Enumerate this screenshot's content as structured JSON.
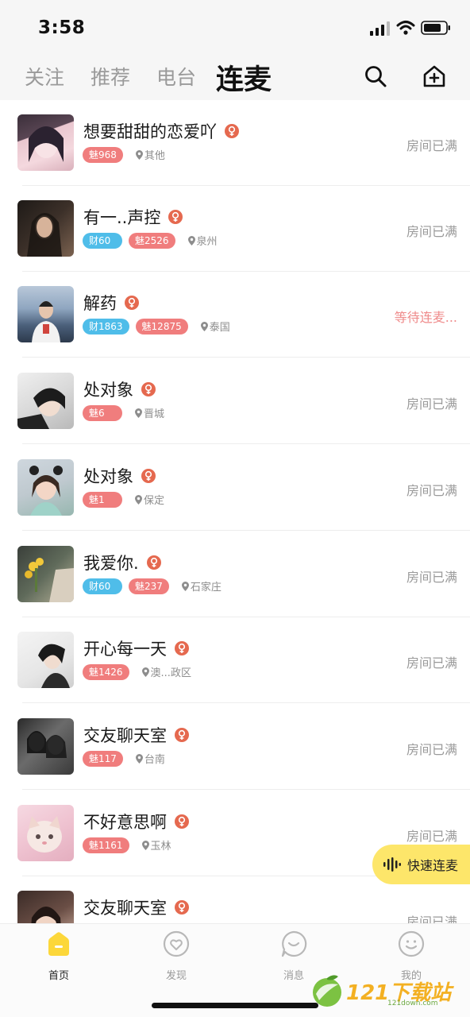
{
  "status_bar": {
    "time": "3:58"
  },
  "top_nav": {
    "tabs": [
      {
        "label": "关注",
        "active": false
      },
      {
        "label": "推荐",
        "active": false
      },
      {
        "label": "电台",
        "active": false
      },
      {
        "label": "连麦",
        "active": true
      }
    ],
    "search_icon": "search-icon",
    "create_icon": "create-room-icon"
  },
  "rooms": [
    {
      "title": "想要甜甜的恋爱吖",
      "wealth": "",
      "charm": "魅968",
      "location": "其他",
      "status": "房间已满",
      "waiting": false
    },
    {
      "title": "有一..声控",
      "wealth": "财60",
      "charm": "魅2526",
      "location": "泉州",
      "status": "房间已满",
      "waiting": false
    },
    {
      "title": "解药",
      "wealth": "财1863",
      "charm": "魅12875",
      "location": "泰国",
      "status": "等待连麦...",
      "waiting": true
    },
    {
      "title": "处对象",
      "wealth": "",
      "charm": "魅6",
      "location": "晋城",
      "status": "房间已满",
      "waiting": false
    },
    {
      "title": "处对象",
      "wealth": "",
      "charm": "魅1",
      "location": "保定",
      "status": "房间已满",
      "waiting": false
    },
    {
      "title": "我爱你.",
      "wealth": "财60",
      "charm": "魅237",
      "location": "石家庄",
      "status": "房间已满",
      "waiting": false
    },
    {
      "title": "开心每一天",
      "wealth": "",
      "charm": "魅1426",
      "location": "澳...政区",
      "status": "房间已满",
      "waiting": false
    },
    {
      "title": "交友聊天室",
      "wealth": "",
      "charm": "魅117",
      "location": "台南",
      "status": "房间已满",
      "waiting": false
    },
    {
      "title": "不好意思啊",
      "wealth": "",
      "charm": "魅1161",
      "location": "玉林",
      "status": "房间已满",
      "waiting": false
    },
    {
      "title": "交友聊天室",
      "wealth": "",
      "charm": "",
      "location": "",
      "status": "房间已满",
      "waiting": false
    }
  ],
  "quick_connect": {
    "label": "快速连麦"
  },
  "bottom_nav": [
    {
      "label": "首页",
      "icon": "home-icon",
      "active": true
    },
    {
      "label": "发现",
      "icon": "discover-icon",
      "active": false
    },
    {
      "label": "消息",
      "icon": "message-icon",
      "active": false
    },
    {
      "label": "我的",
      "icon": "profile-icon",
      "active": false
    }
  ],
  "watermark": {
    "main": "121下载站",
    "sub": "121down.com"
  },
  "colors": {
    "accent_yellow": "#fde66a",
    "charm_tag": "#f07d7d",
    "wealth_tag": "#4fbde9",
    "female_icon": "#e5694f"
  }
}
